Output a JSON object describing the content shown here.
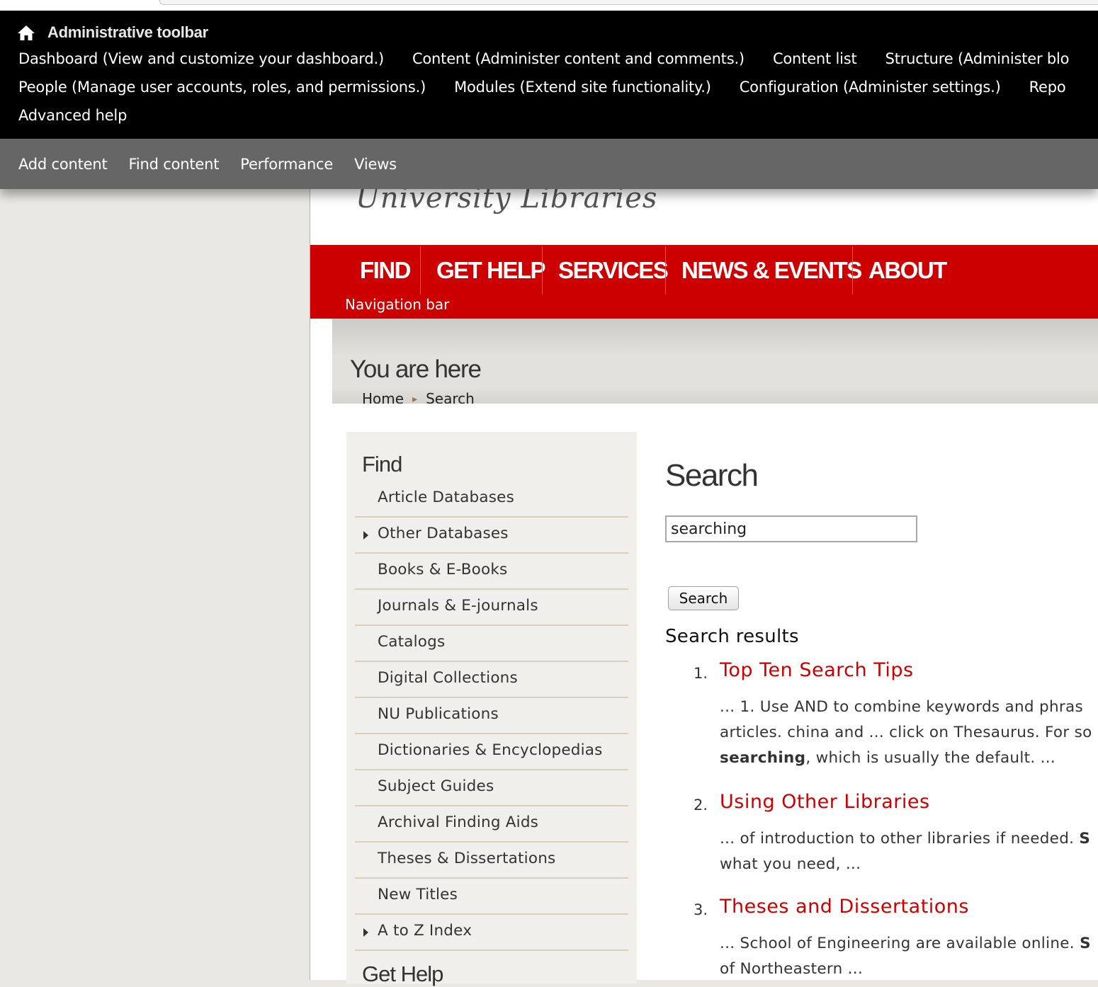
{
  "admin_toolbar": {
    "title": "Administrative toolbar",
    "home_icon": "home-icon",
    "row1": [
      "Dashboard (View and customize your dashboard.)",
      "Content (Administer content and comments.)",
      "Content list",
      "Structure (Administer blo"
    ],
    "row2": [
      "People (Manage user accounts, roles, and permissions.)",
      "Modules (Extend site functionality.)",
      "Configuration (Administer settings.)",
      "Repo"
    ],
    "row3": [
      "Advanced help"
    ]
  },
  "shortcuts": [
    "Add content",
    "Find content",
    "Performance",
    "Views"
  ],
  "site": {
    "logo_text": "University Libraries"
  },
  "main_nav": {
    "items": [
      "FIND",
      "GET HELP",
      "SERVICES",
      "NEWS & EVENTS",
      "ABOUT"
    ],
    "caption": "Navigation bar",
    "color": "#cc0000"
  },
  "breadcrumb": {
    "heading": "You are here",
    "items": [
      "Home",
      "Search"
    ]
  },
  "sidebar": {
    "title": "Find",
    "items": [
      {
        "label": "Article Databases",
        "expandable": false
      },
      {
        "label": "Other Databases",
        "expandable": true
      },
      {
        "label": "Books & E-Books",
        "expandable": false
      },
      {
        "label": "Journals & E-journals",
        "expandable": false
      },
      {
        "label": "Catalogs",
        "expandable": false
      },
      {
        "label": "Digital Collections",
        "expandable": false
      },
      {
        "label": "NU Publications",
        "expandable": false
      },
      {
        "label": "Dictionaries & Encyclopedias",
        "expandable": false
      },
      {
        "label": "Subject Guides",
        "expandable": false
      },
      {
        "label": "Archival Finding Aids",
        "expandable": false
      },
      {
        "label": "Theses & Dissertations",
        "expandable": false
      },
      {
        "label": "New Titles",
        "expandable": false
      },
      {
        "label": "A to Z Index",
        "expandable": true
      }
    ],
    "next_title": "Get Help"
  },
  "content": {
    "title": "Search",
    "search_value": "searching",
    "search_button": "Search",
    "results_heading": "Search results",
    "results": [
      {
        "num": "1.",
        "title": "Top Ten Search Tips",
        "snippet": [
          [
            {
              "t": "... 1. Use AND to combine keywords and phras"
            }
          ],
          [
            {
              "t": "articles. china and ... click on Thesaurus. For so"
            }
          ],
          [
            {
              "t": "searching",
              "b": true
            },
            {
              "t": ", which is usually the default. ..."
            }
          ]
        ]
      },
      {
        "num": "2.",
        "title": "Using Other Libraries",
        "snippet": [
          [
            {
              "t": "... of introduction to other libraries if needed. "
            },
            {
              "t": "S",
              "b": true
            }
          ],
          [
            {
              "t": "what you need, ..."
            }
          ]
        ]
      },
      {
        "num": "3.",
        "title": "Theses and Dissertations",
        "snippet": [
          [
            {
              "t": "... School of Engineering are available online. "
            },
            {
              "t": "S",
              "b": true
            }
          ],
          [
            {
              "t": "of Northeastern ..."
            }
          ]
        ]
      }
    ],
    "link_color": "#cc0000"
  }
}
